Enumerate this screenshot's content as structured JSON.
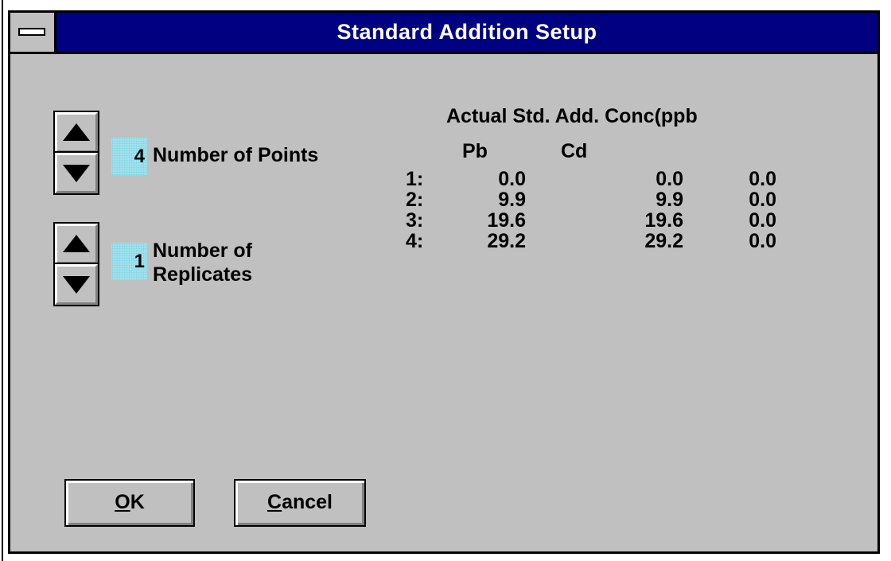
{
  "window": {
    "title": "Standard Addition Setup",
    "system_menu_icon": "system-menu-bar-icon"
  },
  "points": {
    "value": "4",
    "label": "Number of Points"
  },
  "replicates": {
    "value": "1",
    "label_line1": "Number of",
    "label_line2": "Replicates"
  },
  "concentration": {
    "title": "Actual Std. Add. Conc(ppb",
    "columns": [
      "Pb",
      "Cd"
    ],
    "rows": [
      {
        "index": "1:",
        "pb": "0.0",
        "cd": "0.0",
        "third": "0.0"
      },
      {
        "index": "2:",
        "pb": "9.9",
        "cd": "9.9",
        "third": "0.0"
      },
      {
        "index": "3:",
        "pb": "19.6",
        "cd": "19.6",
        "third": "0.0"
      },
      {
        "index": "4:",
        "pb": "29.2",
        "cd": "29.2",
        "third": "0.0"
      }
    ]
  },
  "buttons": {
    "ok_mnemonic": "O",
    "ok_rest": "K",
    "cancel_mnemonic": "C",
    "cancel_rest": "ancel"
  },
  "colors": {
    "title_bar": "#000080",
    "window_bg": "#c0c0c0",
    "value_field": "#a8e4ee"
  }
}
